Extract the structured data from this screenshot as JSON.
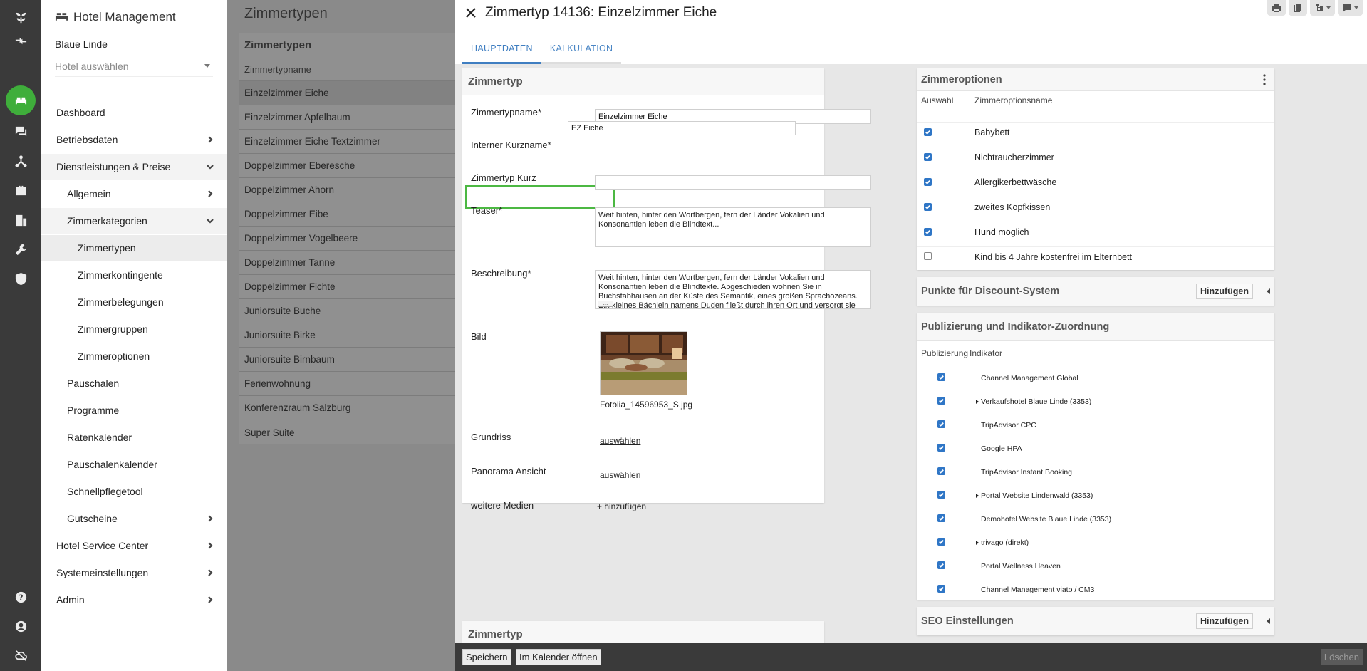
{
  "app": {
    "title": "Hotel Management"
  },
  "hotel": {
    "name": "Blaue Linde",
    "select_placeholder": "Hotel auswählen"
  },
  "nav": {
    "dashboard": "Dashboard",
    "betriebsdaten": "Betriebsdaten",
    "dienstleistungen": "Dienstleistungen & Preise",
    "allgemein": "Allgemein",
    "zimmerkategorien": "Zimmerkategorien",
    "zimmertypen": "Zimmertypen",
    "zimmerkontingente": "Zimmerkontingente",
    "zimmerbelegungen": "Zimmerbelegungen",
    "zimmergruppen": "Zimmergruppen",
    "zimmeroptionen": "Zimmeroptionen",
    "pauschalen": "Pauschalen",
    "programme": "Programme",
    "ratenkalender": "Ratenkalender",
    "pauschalenkalender": "Pauschalenkalender",
    "schnellpflegetool": "Schnellpflegetool",
    "gutscheine": "Gutscheine",
    "hotel_service_center": "Hotel Service Center",
    "systemeinstellungen": "Systemeinstellungen",
    "admin": "Admin"
  },
  "list": {
    "title": "Zimmertypen",
    "card_title": "Zimmertypen",
    "column": "Zimmertypname",
    "rows": [
      "Einzelzimmer Eiche",
      "Einzelzimmer Apfelbaum",
      "Einzelzimmer Eiche Textzimmer",
      "Doppelzimmer Eberesche",
      "Doppelzimmer Ahorn",
      "Doppelzimmer Eibe",
      "Doppelzimmer Vogelbeere",
      "Doppelzimmer Tanne",
      "Doppelzimmer Fichte",
      "Juniorsuite Buche",
      "Juniorsuite Birke",
      "Juniorsuite Birnbaum",
      "Ferienwohnung",
      "Konferenzraum Salzburg",
      "Super Suite"
    ]
  },
  "dialog": {
    "title": "Zimmertyp 14136: Einzelzimmer Eiche",
    "tabs": [
      "HAUPTDATEN",
      "KALKULATION"
    ],
    "form": {
      "card_title": "Zimmertyp",
      "name_label": "Zimmertypname*",
      "name_value": "Einzelzimmer Eiche",
      "short_label": "Interner Kurzname*",
      "short_value": "EZ Eiche",
      "kurz_label": "Zimmertyp Kurz",
      "kurz_value": "",
      "teaser_label": "Teaser*",
      "teaser_value": "Weit hinten, hinter den Wortbergen, fern der Länder Vokalien und Konsonantien leben die Blindtext...",
      "beschreibung_label": "Beschreibung*",
      "beschreibung_value": "Weit hinten, hinter den Wortbergen, fern der Länder Vokalien und Konsonantien leben die Blindtexte. Abgeschieden wohnen Sie in Buchstabhausen an der Küste des Semantik, eines großen Sprachozeans. Ein kleines Bächlein namens Duden fließt durch ihren Ort und versorgt sie mit den",
      "more_label": "...",
      "bild_label": "Bild",
      "bild_file": "Fotolia_14596953_S.jpg",
      "grundriss_label": "Grundriss",
      "grundriss_link": "auswählen",
      "panorama_label": "Panorama Ansicht",
      "panorama_link": "auswählen",
      "medien_label": "weitere Medien",
      "medien_link": "+ hinzufügen",
      "second_card_title": "Zimmertyp"
    },
    "options": {
      "title": "Zimmeroptionen",
      "col_select": "Auswahl",
      "col_name": "Zimmeroptionsname",
      "rows": [
        {
          "label": "Babybett",
          "checked": true
        },
        {
          "label": "Nichtraucherzimmer",
          "checked": true
        },
        {
          "label": "Allergikerbettwäsche",
          "checked": true
        },
        {
          "label": "zweites Kopfkissen",
          "checked": true
        },
        {
          "label": "Hund möglich",
          "checked": true
        },
        {
          "label": "Kind bis 4 Jahre kostenfrei im Elternbett",
          "checked": false
        }
      ]
    },
    "discount": {
      "title": "Punkte für Discount-System",
      "add_label": "Hinzufügen"
    },
    "publish": {
      "title": "Publizierung und Indikator-Zuordnung",
      "col_pub": "Publizierung",
      "col_ind": "Indikator",
      "rows": [
        {
          "label": "Channel Management Global",
          "checked": true,
          "expandable": false
        },
        {
          "label": "Verkaufshotel Blaue Linde (3353)",
          "checked": true,
          "expandable": true
        },
        {
          "label": "TripAdvisor CPC",
          "checked": true,
          "expandable": false
        },
        {
          "label": "Google HPA",
          "checked": true,
          "expandable": false
        },
        {
          "label": "TripAdvisor Instant Booking",
          "checked": true,
          "expandable": false
        },
        {
          "label": "Portal Website Lindenwald (3353)",
          "checked": true,
          "expandable": true
        },
        {
          "label": "Demohotel Website Blaue Linde (3353)",
          "checked": true,
          "expandable": false
        },
        {
          "label": "trivago (direkt)",
          "checked": true,
          "expandable": true
        },
        {
          "label": "Portal Wellness Heaven",
          "checked": true,
          "expandable": false
        },
        {
          "label": "Channel Management viato / CM3",
          "checked": true,
          "expandable": false
        }
      ]
    },
    "seo": {
      "title": "SEO Einstellungen",
      "add_label": "Hinzufügen"
    },
    "footer": {
      "save": "Speichern",
      "calendar": "Im Kalender öffnen",
      "delete": "Löschen"
    }
  },
  "colors": {
    "accent_green": "#3fae3b",
    "highlight_green": "#4cb843",
    "tab_blue": "#3f7ec1",
    "checkbox_blue": "#2f76c6",
    "rail": "#3a3a3a"
  }
}
